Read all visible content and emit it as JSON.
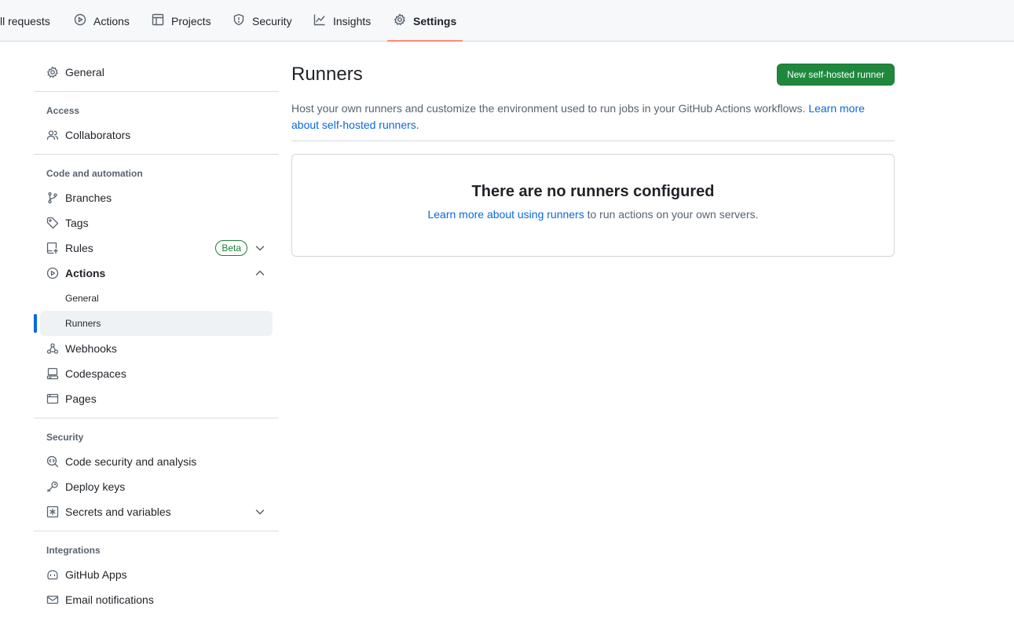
{
  "repo_nav": {
    "tabs": [
      {
        "label": "Pull requests",
        "icon": "pull-request-icon"
      },
      {
        "label": "Actions",
        "icon": "play-icon"
      },
      {
        "label": "Projects",
        "icon": "table-icon"
      },
      {
        "label": "Security",
        "icon": "shield-icon"
      },
      {
        "label": "Insights",
        "icon": "graph-icon"
      },
      {
        "label": "Settings",
        "icon": "gear-icon",
        "selected": true
      }
    ],
    "visible_first_tab_text": "ll requests"
  },
  "sidebar": {
    "general": "General",
    "access": {
      "heading": "Access",
      "items": [
        "Collaborators"
      ]
    },
    "code_automation": {
      "heading": "Code and automation",
      "branches": "Branches",
      "tags": "Tags",
      "rules": "Rules",
      "rules_badge": "Beta",
      "actions": "Actions",
      "actions_general": "General",
      "actions_runners": "Runners",
      "webhooks": "Webhooks",
      "codespaces": "Codespaces",
      "pages": "Pages"
    },
    "security": {
      "heading": "Security",
      "code_security": "Code security and analysis",
      "deploy_keys": "Deploy keys",
      "secrets": "Secrets and variables"
    },
    "integrations": {
      "heading": "Integrations",
      "github_apps": "GitHub Apps",
      "email": "Email notifications"
    }
  },
  "main": {
    "title": "Runners",
    "new_button": "New self-hosted runner",
    "description": "Host your own runners and customize the environment used to run jobs in your GitHub Actions workflows. ",
    "description_link": "Learn more about self-hosted runners.",
    "blankslate": {
      "heading": "There are no runners configured",
      "link": "Learn more about using runners",
      "text": " to run actions on your own servers."
    }
  },
  "colors": {
    "accent": "#0969da",
    "primary_button": "#1f883d",
    "tab_underline": "#fd8c73",
    "beta_badge": "#1a7f37"
  }
}
